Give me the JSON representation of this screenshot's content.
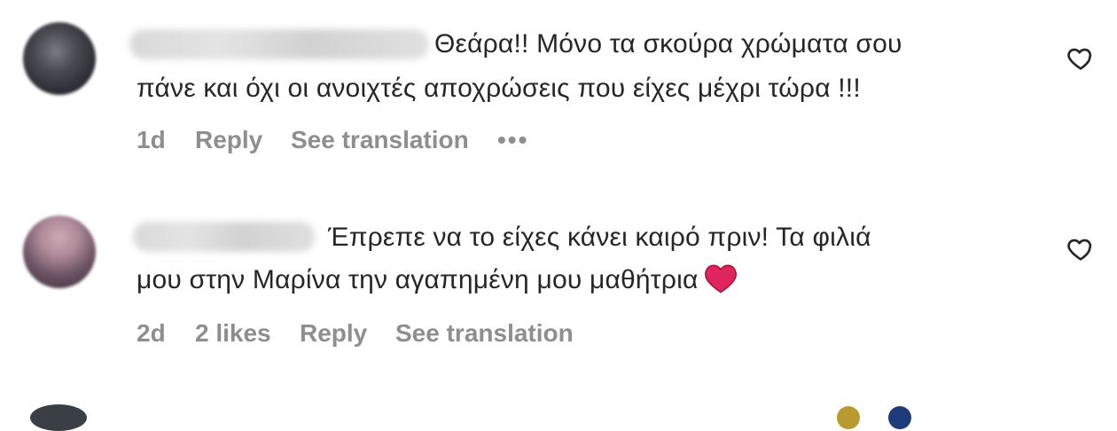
{
  "comments": [
    {
      "text_line1": "Θεάρα!! Μόνο τα σκούρα χρώματα σου",
      "text_line2": "πάνε και όχι οι ανοιχτές αποχρώσεις που είχες μέχρι τώρα !!!",
      "time": "1d",
      "reply_label": "Reply",
      "translate_label": "See translation",
      "more_label": "•••"
    },
    {
      "text_line1": "Έπρεπε να το είχες κάνει καιρό πριν! Τα φιλιά",
      "text_line2": "μου στην Μαρίνα την αγαπημένη μου μαθήτρια",
      "time": "2d",
      "likes": "2 likes",
      "reply_label": "Reply",
      "translate_label": "See translation"
    }
  ],
  "colors": {
    "text": "#262626",
    "meta": "#8e8e8e",
    "heart_emoji": "#e0245e"
  }
}
